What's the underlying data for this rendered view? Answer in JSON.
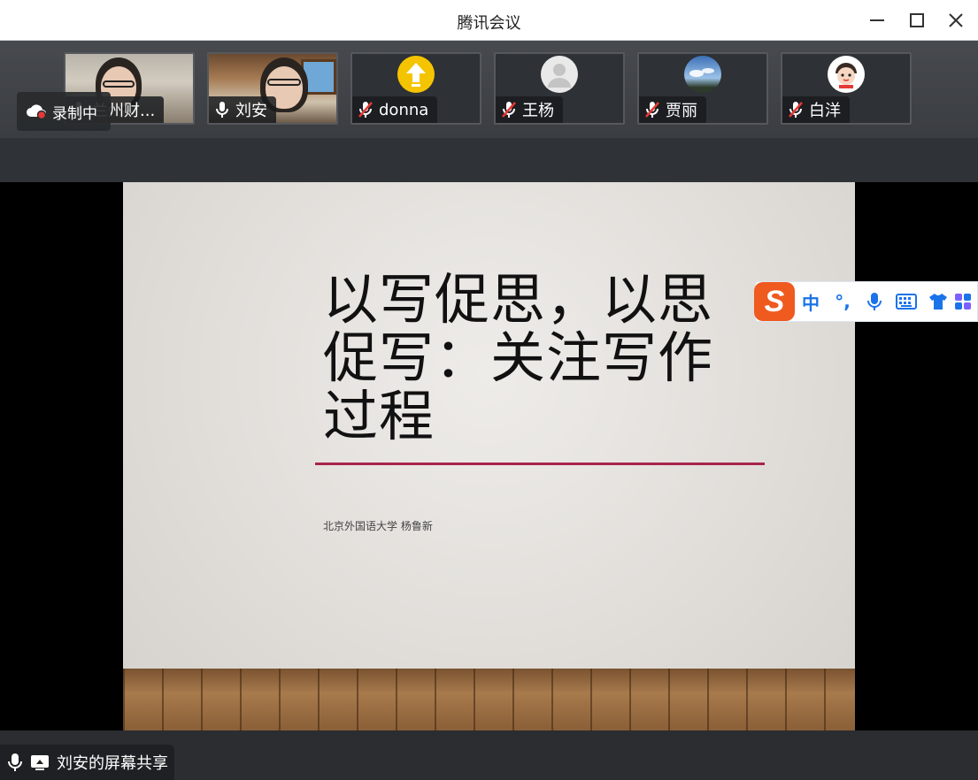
{
  "window": {
    "title": "腾讯会议"
  },
  "recording": {
    "label": "录制中"
  },
  "participants": [
    {
      "name": "兰州财...",
      "type": "video",
      "muted": false
    },
    {
      "name": "刘安",
      "type": "video",
      "muted": false
    },
    {
      "name": "donna",
      "type": "avatar",
      "avatar_icon": "upload-arrow-icon",
      "avatar_color": "#f5c400",
      "muted": true
    },
    {
      "name": "王杨",
      "type": "avatar",
      "avatar_icon": "default-user-icon",
      "avatar_color": "#e9e9e9",
      "muted": true
    },
    {
      "name": "贾丽",
      "type": "avatar",
      "avatar_icon": "sky-photo-icon",
      "avatar_color": "#4a7fc1",
      "muted": true
    },
    {
      "name": "白洋",
      "type": "avatar",
      "avatar_icon": "cartoon-face-icon",
      "avatar_color": "#ffffff",
      "muted": true
    }
  ],
  "slide": {
    "title": "以写促思，以思促写：关注写作过程",
    "subtitle": "北京外国语大学 杨鲁新",
    "accent_color": "#a8244a"
  },
  "ime": {
    "logo": "S",
    "mode": "中",
    "punct": "°,",
    "icons": [
      "microphone-icon",
      "keyboard-icon",
      "skin-shirt-icon",
      "toolbox-icon"
    ]
  },
  "share": {
    "label": "刘安的屏幕共享"
  }
}
